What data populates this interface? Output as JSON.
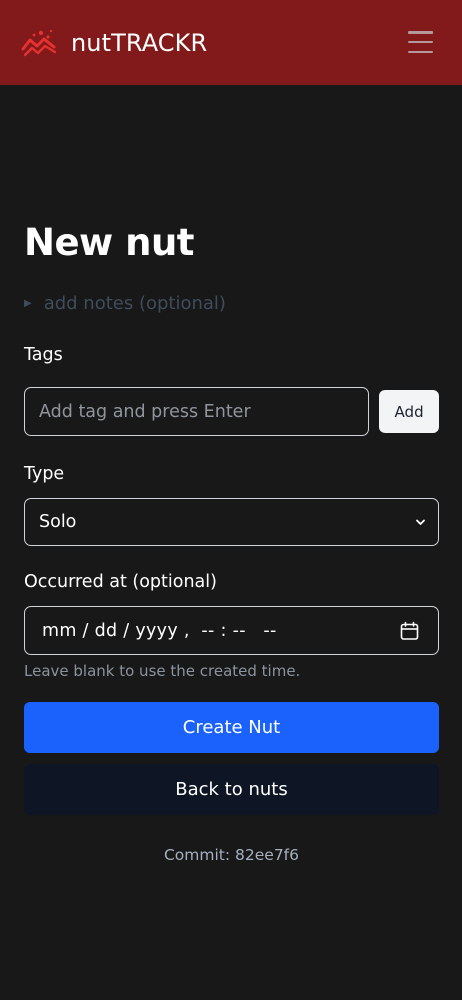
{
  "app": {
    "brand_name": "nutTRACKR",
    "logo_icon": "trend-zigzag-icon",
    "menu_icon": "hamburger-menu-icon",
    "colors": {
      "navbar": "#82191a",
      "background": "#181818",
      "primary": "#1a62fb",
      "secondary": "#0e1524"
    }
  },
  "form": {
    "title": "New nut",
    "notes_toggle": "add notes (optional)",
    "tags": {
      "label": "Tags",
      "placeholder": "Add tag and press Enter",
      "value": "",
      "add_label": "Add"
    },
    "type": {
      "label": "Type",
      "selected": "Solo"
    },
    "occurred": {
      "label": "Occurred at (optional)",
      "display": "mm / dd / yyyy ,  -- : --   --",
      "help": "Leave blank to use the created time.",
      "icon": "calendar-icon"
    },
    "submit_label": "Create Nut",
    "back_label": "Back to nuts"
  },
  "footer": {
    "commit": "Commit: 82ee7f6"
  }
}
